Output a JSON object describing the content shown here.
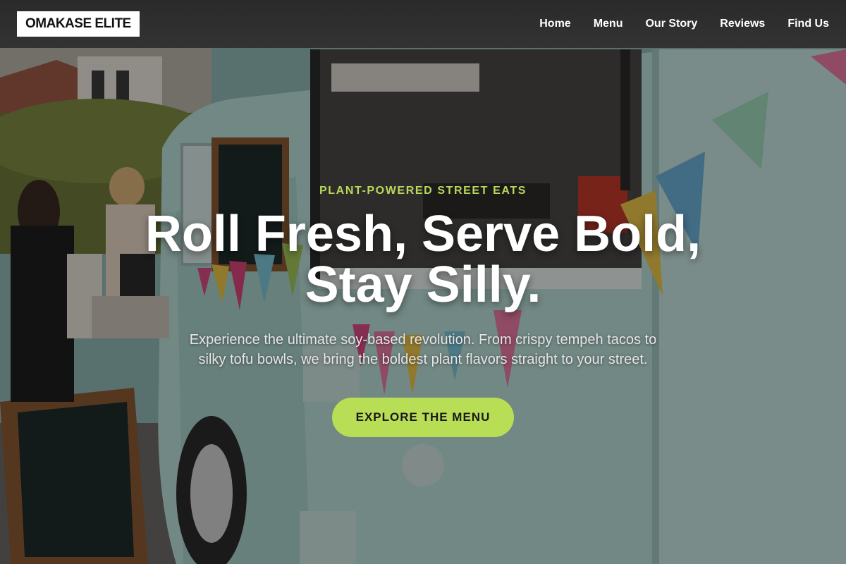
{
  "header": {
    "brand": "OMAKASE ELITE",
    "nav": [
      {
        "label": "Home"
      },
      {
        "label": "Menu"
      },
      {
        "label": "Our Story"
      },
      {
        "label": "Reviews"
      },
      {
        "label": "Find Us"
      }
    ]
  },
  "hero": {
    "eyebrow": "PLANT-POWERED STREET EATS",
    "title": "Roll Fresh, Serve Bold, Stay Silly.",
    "subtitle": "Experience the ultimate soy-based revolution. From crispy tempeh tacos to silky tofu bowls, we bring the boldest plant flavors straight to your street.",
    "cta_label": "EXPLORE THE MENU",
    "background_description_icon": "food-truck-photo"
  },
  "colors": {
    "accent": "#b8de55",
    "eyebrow": "#b8d85a",
    "header_bg": "#2f2f2f",
    "logo_bg": "#ffffff"
  }
}
